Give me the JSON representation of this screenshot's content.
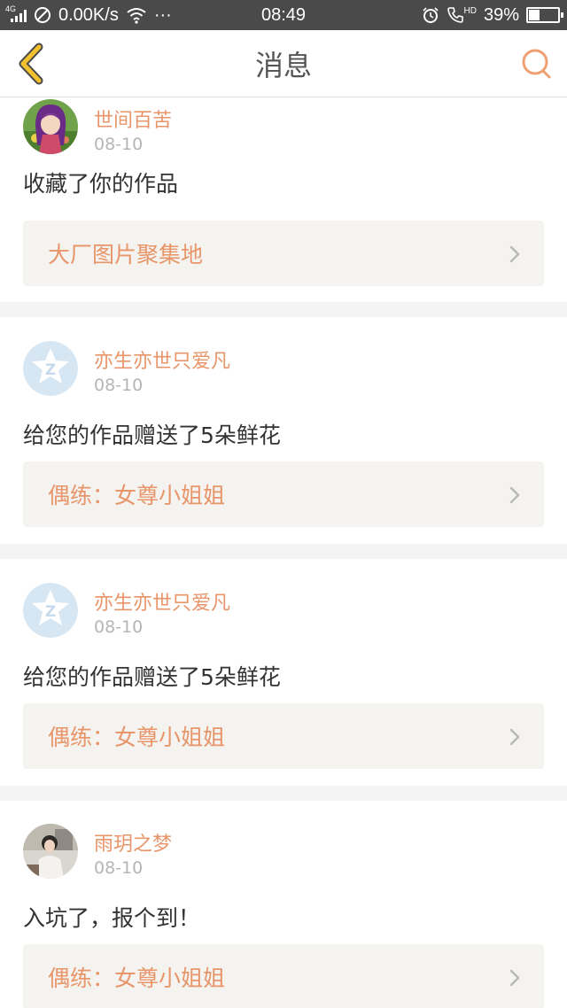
{
  "status_bar": {
    "network_type": "4G",
    "speed": "0.00K/s",
    "more": "···",
    "time": "08:49",
    "hd": "HD",
    "battery_percent": "39%",
    "battery_level": 0.39
  },
  "header": {
    "title": "消息",
    "back_icon": "chevron-left-icon",
    "search_icon": "search-icon",
    "accent_color": "#f2c12e"
  },
  "colors": {
    "name": "#e8956a",
    "link": "#e8956a",
    "date": "#b5b5b5",
    "message": "#333333",
    "link_bg": "#f4f3ef",
    "separator": "#f3f3f3"
  },
  "messages": [
    {
      "username": "世间百苦",
      "date": "08-10",
      "text": "收藏了你的作品",
      "link": "大厂图片聚集地",
      "avatar": "anime-girl-avatar"
    },
    {
      "username": "亦生亦世只爱凡",
      "date": "08-10",
      "text": "给您的作品赠送了5朵鲜花",
      "link": "偶练：女尊小姐姐",
      "avatar": "qq-default-avatar"
    },
    {
      "username": "亦生亦世只爱凡",
      "date": "08-10",
      "text": "给您的作品赠送了5朵鲜花",
      "link": "偶练：女尊小姐姐",
      "avatar": "qq-default-avatar"
    },
    {
      "username": "雨玥之梦",
      "date": "08-10",
      "text": "入坑了，报个到！",
      "link": "偶练：女尊小姐姐",
      "avatar": "photo-avatar"
    }
  ]
}
